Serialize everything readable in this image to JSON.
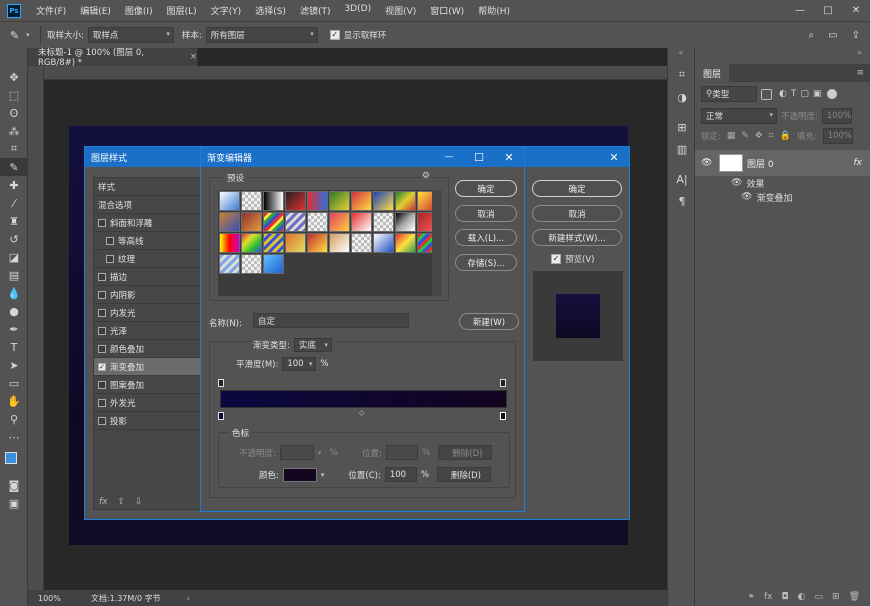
{
  "menubar": {
    "logo": "Ps",
    "items": [
      "文件(F)",
      "编辑(E)",
      "图像(I)",
      "图层(L)",
      "文字(Y)",
      "选择(S)",
      "滤镜(T)",
      "3D(D)",
      "视图(V)",
      "窗口(W)",
      "帮助(H)"
    ],
    "min": "—",
    "max": "□",
    "close": "✕"
  },
  "options": {
    "sample_size_label": "取样大小:",
    "sample_size_value": "取样点",
    "sample_label": "样本:",
    "sample_value": "所有图层",
    "show_ring_label": "显示取样环"
  },
  "document": {
    "tab_title": "未标题-1 @ 100% (图层 0, RGB/8#) *",
    "tab_close": "×",
    "zoom": "100%",
    "doc_info": "文档:1.37M/0 字节",
    "canvas_top": "#14103f",
    "canvas_bottom": "#120b25"
  },
  "layers_panel": {
    "title": "图层",
    "filter_label": "类型",
    "blend_mode": "正常",
    "opacity_label": "不透明度:",
    "opacity_value": "100%",
    "lock_label": "锁定:",
    "fill_label": "填充:",
    "fill_value": "100%",
    "layer_name": "图层 0",
    "fx": "fx",
    "effects_label": "效果",
    "effect_item": "渐变叠加"
  },
  "layer_style": {
    "title": "图层样式",
    "items": [
      {
        "label": "样式",
        "check": null,
        "indent": false
      },
      {
        "label": "混合选项",
        "check": null,
        "indent": false
      },
      {
        "label": "斜面和浮雕",
        "check": false,
        "indent": false
      },
      {
        "label": "等高线",
        "check": false,
        "indent": true
      },
      {
        "label": "纹理",
        "check": false,
        "indent": true
      },
      {
        "label": "描边",
        "check": false,
        "indent": false
      },
      {
        "label": "内阴影",
        "check": false,
        "indent": false
      },
      {
        "label": "内发光",
        "check": false,
        "indent": false
      },
      {
        "label": "光泽",
        "check": false,
        "indent": false
      },
      {
        "label": "颜色叠加",
        "check": false,
        "indent": false
      },
      {
        "label": "渐变叠加",
        "check": true,
        "indent": false
      },
      {
        "label": "图案叠加",
        "check": false,
        "indent": false
      },
      {
        "label": "外发光",
        "check": false,
        "indent": false
      },
      {
        "label": "投影",
        "check": false,
        "indent": false
      }
    ],
    "fx": "fx",
    "ok": "确定",
    "cancel": "取消",
    "new_style": "新建样式(W)...",
    "preview": "预览(V)"
  },
  "gradient_editor": {
    "title": "渐变编辑器",
    "presets_label": "预设",
    "ok": "确定",
    "cancel": "取消",
    "load": "载入(L)...",
    "save": "存储(S)...",
    "name_label": "名称(N):",
    "name_value": "自定",
    "new_button": "新建(W)",
    "type_label": "渐变类型:",
    "type_value": "实底",
    "smooth_label": "平滑度(M):",
    "smooth_value": "100",
    "percent": "%",
    "stops_label": "色标",
    "opacity_label": "不透明度:",
    "location_label": "位置:",
    "delete_label": "删除(D)",
    "color_label": "颜色:",
    "location_c_label": "位置(C):",
    "location_value": "100",
    "gradient_start": "#0a0840",
    "gradient_end": "#140520"
  }
}
